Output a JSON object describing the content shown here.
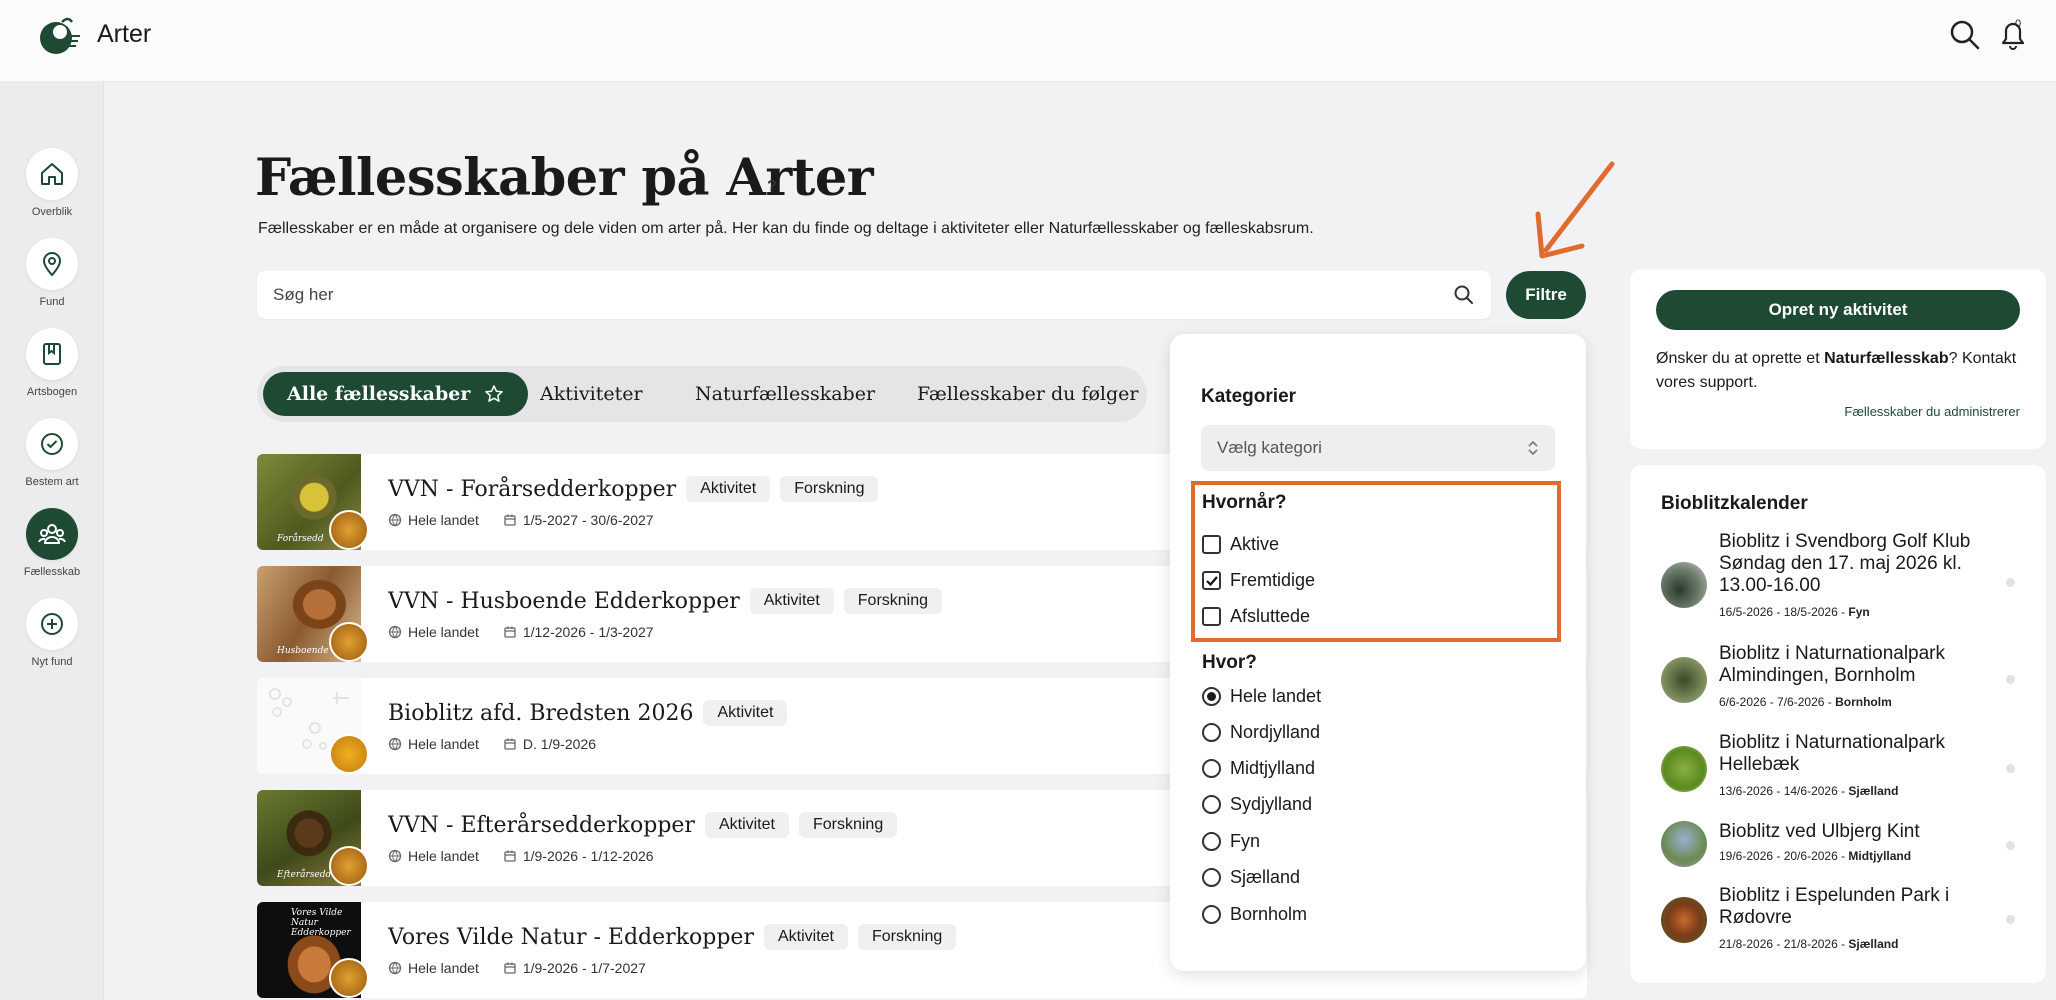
{
  "app": {
    "title": "Arter",
    "notification_count": "0"
  },
  "sidebar": {
    "items": [
      {
        "label": "Overblik",
        "icon": "home-icon"
      },
      {
        "label": "Fund",
        "icon": "map-pin-icon"
      },
      {
        "label": "Artsbogen",
        "icon": "book-icon"
      },
      {
        "label": "Bestem art",
        "icon": "check-circle-icon"
      },
      {
        "label": "Fællesskab",
        "icon": "community-icon"
      },
      {
        "label": "Nyt fund",
        "icon": "plus-circle-icon"
      }
    ]
  },
  "page": {
    "title": "Fællesskaber på Arter",
    "help": "?",
    "subtitle": "Fællesskaber er en måde at organisere og dele viden om arter på. Her kan du finde og deltage i aktiviteter eller Naturfællesskaber og fælleskabsrum."
  },
  "search": {
    "placeholder": "Søg her",
    "value": ""
  },
  "filter_button": "Filtre",
  "tabs": [
    "Alle fællesskaber",
    "Aktiviteter",
    "Naturfællesskaber",
    "Fællesskaber du følger"
  ],
  "cards": [
    {
      "title": "VVN - Forårsedderkopper",
      "badges": [
        "Aktivitet",
        "Forskning"
      ],
      "area": "Hele landet",
      "dates": "1/5-2027 - 30/6-2027",
      "caption": "Forårsedd"
    },
    {
      "title": "VVN - Husboende Edderkopper",
      "badges": [
        "Aktivitet",
        "Forskning"
      ],
      "area": "Hele landet",
      "dates": "1/12-2026 - 1/3-2027",
      "caption": "Husboende"
    },
    {
      "title": "Bioblitz afd. Bredsten 2026",
      "badges": [
        "Aktivitet"
      ],
      "area": "Hele landet",
      "dates": "D. 1/9-2026",
      "caption": ""
    },
    {
      "title": "VVN - Efterårsedderkopper",
      "badges": [
        "Aktivitet",
        "Forskning"
      ],
      "area": "Hele landet",
      "dates": "1/9-2026 - 1/12-2026",
      "caption": "Efterårsedd"
    },
    {
      "title": "Vores Vilde Natur - Edderkopper",
      "badges": [
        "Aktivitet",
        "Forskning"
      ],
      "area": "Hele landet",
      "dates": "1/9-2026 - 1/7-2027",
      "caption": "Vores Vilde Natur Edderkopper"
    }
  ],
  "filter_panel": {
    "category_heading": "Kategorier",
    "category_placeholder": "Vælg kategori",
    "when_heading": "Hvornår?",
    "when_options": [
      {
        "label": "Aktive",
        "checked": false
      },
      {
        "label": "Fremtidige",
        "checked": true
      },
      {
        "label": "Afsluttede",
        "checked": false
      }
    ],
    "where_heading": "Hvor?",
    "where_options": [
      {
        "label": "Hele landet",
        "selected": true
      },
      {
        "label": "Nordjylland",
        "selected": false
      },
      {
        "label": "Midtjylland",
        "selected": false
      },
      {
        "label": "Sydjylland",
        "selected": false
      },
      {
        "label": "Fyn",
        "selected": false
      },
      {
        "label": "Sjælland",
        "selected": false
      },
      {
        "label": "Bornholm",
        "selected": false
      }
    ]
  },
  "create_card": {
    "button": "Opret ny aktivitet",
    "text_before": "Ønsker du at oprette et ",
    "text_bold": "Naturfællesskab",
    "text_after": "? Kontakt vores support.",
    "link": "Fællesskaber du administrerer"
  },
  "calendar": {
    "title": "Bioblitzkalender",
    "events": [
      {
        "name": "Bioblitz i Svendborg Golf Klub Søndag den 17. maj 2026 kl. 13.00-16.00",
        "dates": "16/5-2026 - 18/5-2026 - ",
        "region": "Fyn"
      },
      {
        "name": "Bioblitz i Naturnationalpark Almindingen, Bornholm",
        "dates": "6/6-2026 - 7/6-2026 - ",
        "region": "Bornholm"
      },
      {
        "name": "Bioblitz i Naturnationalpark Hellebæk",
        "dates": "13/6-2026 - 14/6-2026 - ",
        "region": "Sjælland"
      },
      {
        "name": "Bioblitz ved Ulbjerg Kint",
        "dates": "19/6-2026 - 20/6-2026 - ",
        "region": "Midtjylland"
      },
      {
        "name": "Bioblitz i Espelunden Park i Rødovre",
        "dates": "21/8-2026 - 21/8-2026 - ",
        "region": "Sjælland"
      }
    ]
  },
  "colors": {
    "accent": "#1e4a33",
    "highlight": "#e06b2d",
    "background": "#f2f2f4"
  }
}
